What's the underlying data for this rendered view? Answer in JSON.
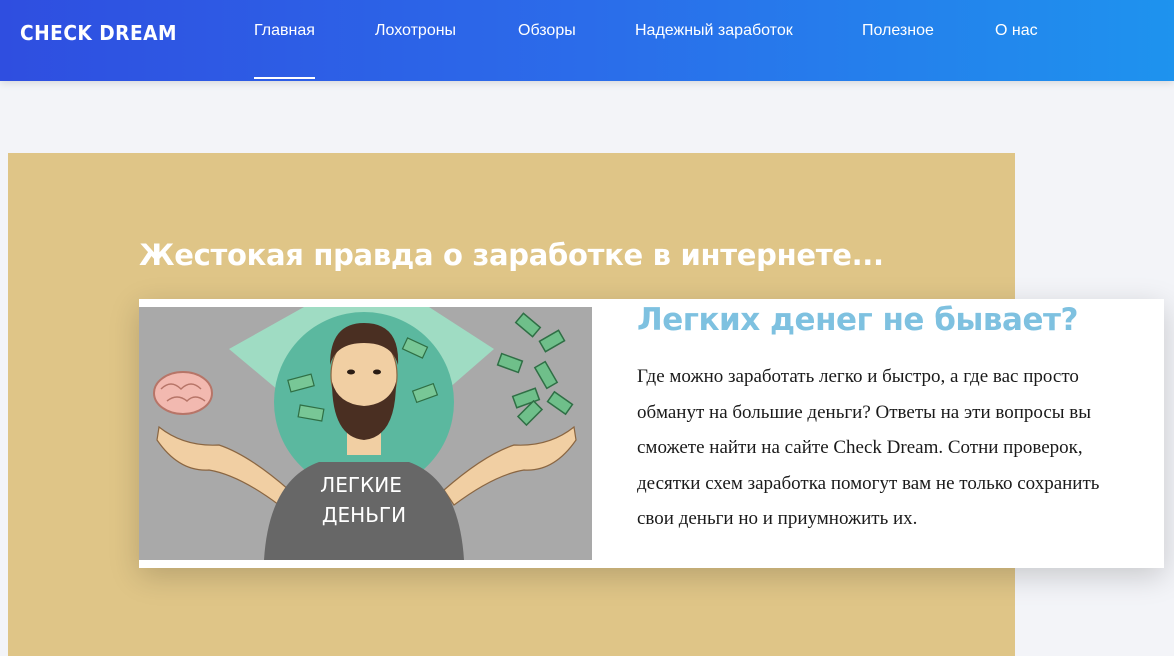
{
  "header": {
    "logo": "CHECK DREAM",
    "nav": [
      {
        "label": "Главная",
        "active": true
      },
      {
        "label": "Лохотроны",
        "active": false
      },
      {
        "label": "Обзоры",
        "active": false
      },
      {
        "label": "Надежный заработок",
        "active": false
      },
      {
        "label": "Полезное",
        "active": false
      },
      {
        "label": "О нас",
        "active": false
      }
    ]
  },
  "hero": {
    "headline": "Жестокая правда о заработке в интернете...",
    "card": {
      "title": "Легких денег не бывает?",
      "text": "Где можно заработать легко и быстро, а где вас просто обманут на большие деньги? Ответы на эти вопросы вы сможете найти на сайте Check Dream. Сотни проверок, десятки схем заработка помогут вам не только сохранить свои деньги но и приумножить их.",
      "image": {
        "shirt_text_line1": "ЛЕГКИЕ",
        "shirt_text_line2": "ДЕНЬГИ"
      }
    }
  },
  "colors": {
    "header_gradient_start": "#2f4ee0",
    "header_gradient_end": "#1e93ee",
    "banner": "#dfc587",
    "card_title": "#7ec1e0"
  }
}
